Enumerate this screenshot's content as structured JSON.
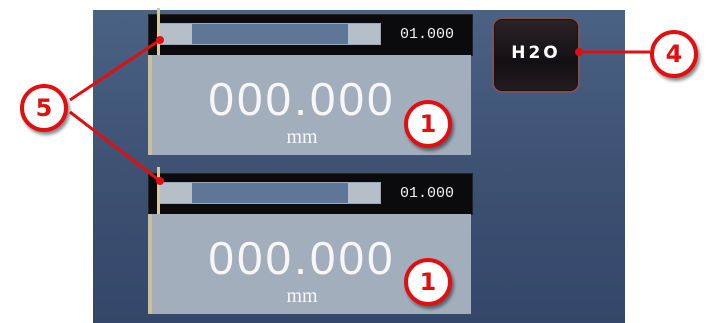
{
  "gauges": [
    {
      "bar_value": "01.000",
      "readout_value": "000.000",
      "readout_unit": "mm"
    },
    {
      "bar_value": "01.000",
      "readout_value": "000.000",
      "readout_unit": "mm"
    }
  ],
  "h2o_button": {
    "label": "H2O"
  },
  "callouts": {
    "readout_1": "1",
    "readout_2": "1",
    "h2o": "4",
    "bars": "5"
  },
  "colors": {
    "callout_red": "#e10f0f",
    "panel_blue": "#3d5273"
  }
}
